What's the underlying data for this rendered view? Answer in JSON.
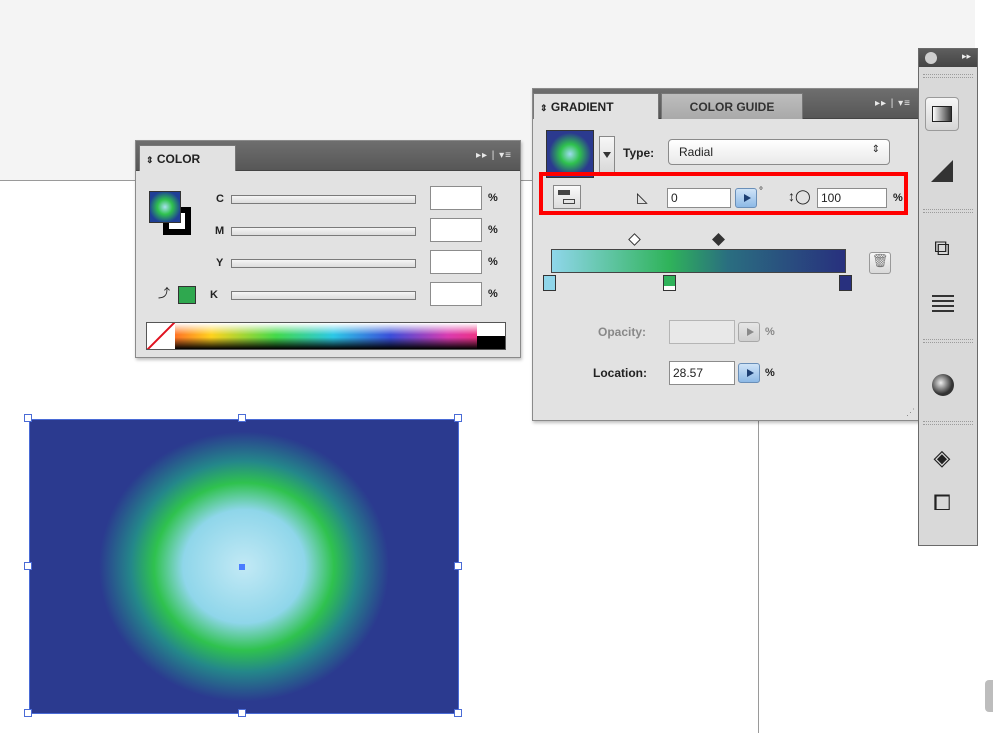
{
  "color_panel": {
    "tab": "COLOR",
    "channels": [
      {
        "label": "C",
        "value": ""
      },
      {
        "label": "M",
        "value": ""
      },
      {
        "label": "Y",
        "value": ""
      },
      {
        "label": "K",
        "value": ""
      }
    ],
    "percent": "%",
    "colors": {
      "fill": "#1f3f96",
      "stroke": "#000000",
      "out_of_gamut": "#2fa84f"
    }
  },
  "gradient_panel": {
    "tabs": [
      "GRADIENT",
      "COLOR GUIDE"
    ],
    "type_label": "Type:",
    "type_value": "Radial",
    "angle": "0",
    "degree": "°",
    "aspect_ratio": "100",
    "aspect_unit": "%",
    "opacity_label": "Opacity:",
    "opacity_value": "",
    "opacity_unit": "%",
    "location_label": "Location:",
    "location_value": "28.57",
    "location_unit": "%",
    "stops": [
      "#8fd6ea",
      "#2fb35a",
      "#28307e"
    ],
    "highlight_color": "#ff0000"
  },
  "toolbar": {
    "tools": [
      "gradient-tool",
      "transparency-tool",
      "transform-tool",
      "stroke-tool",
      "appearance-tool",
      "layers-tool",
      "artboards-tool"
    ]
  },
  "canvas": {
    "rect_colors": {
      "center": "#9fdcf0",
      "mid": "#2fc24e",
      "edge": "#2b3a8f"
    }
  }
}
